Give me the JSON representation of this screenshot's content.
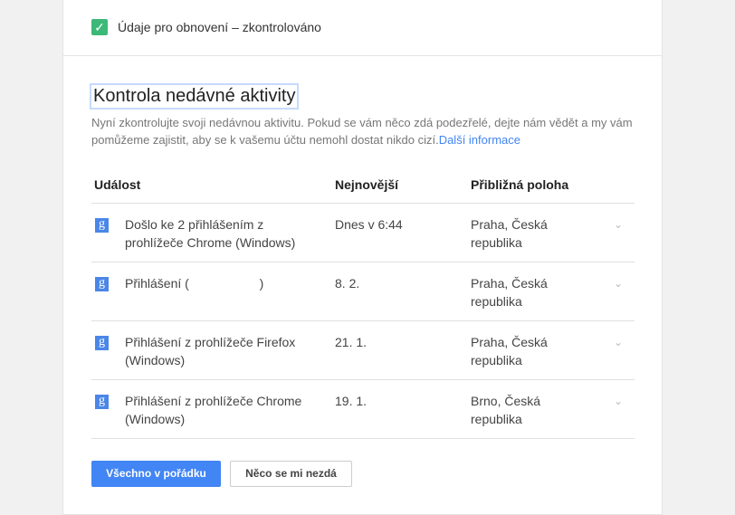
{
  "recovery": {
    "label": "Údaje pro obnovení – zkontrolováno"
  },
  "activity": {
    "title": "Kontrola nedávné aktivity",
    "description": "Nyní zkontrolujte svoji nedávnou aktivitu. Pokud se vám něco zdá podezřelé, dejte nám vědět a my vám pomůžeme zajistit, aby se k vašemu účtu nemohl dostat nikdo cizí.",
    "learn_more": "Další informace",
    "columns": [
      "Událost",
      "Nejnovější",
      "Přibližná poloha"
    ],
    "rows": [
      {
        "event": "Došlo ke 2 přihlášením z prohlížeče Chrome (Windows)",
        "date": "Dnes v 6:44",
        "location": "Praha, Česká republika"
      },
      {
        "event": "Přihlášení (                    )",
        "date": "8. 2.",
        "location": "Praha, Česká republika"
      },
      {
        "event": "Přihlášení z prohlížeče Firefox (Windows)",
        "date": "21. 1.",
        "location": "Praha, Česká republika"
      },
      {
        "event": "Přihlášení z prohlížeče Chrome (Windows)",
        "date": "19. 1.",
        "location": "Brno, Česká republika"
      }
    ],
    "ok_button": "Všechno v pořádku",
    "suspicious_button": "Něco se mi nezdá"
  }
}
